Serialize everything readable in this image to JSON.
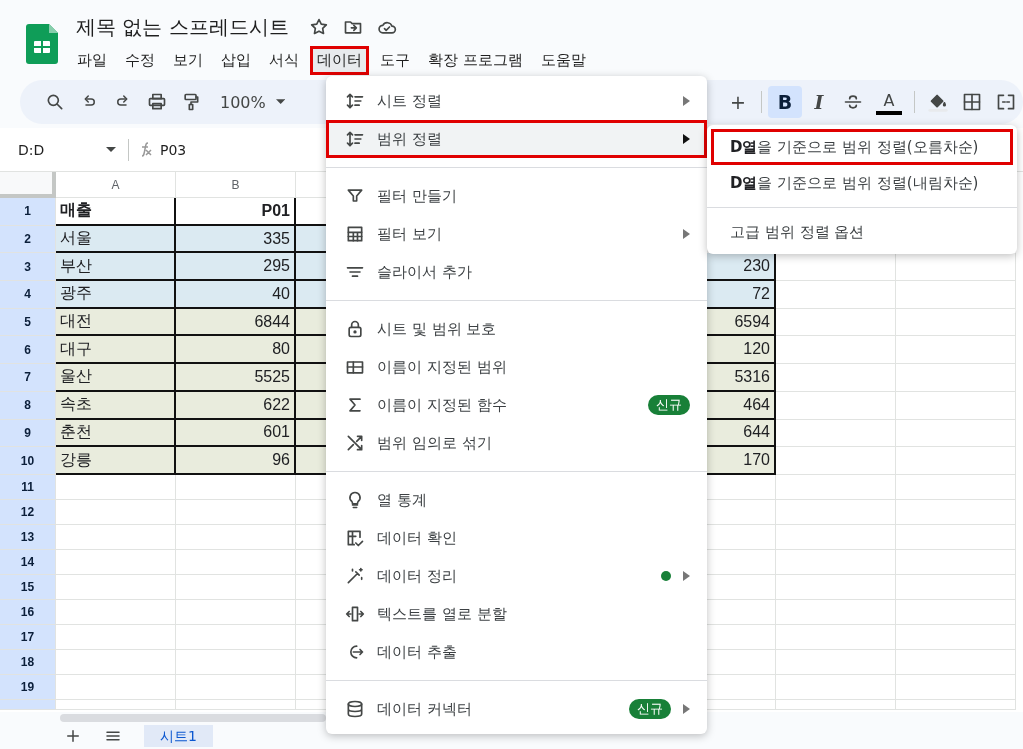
{
  "title": "제목 없는 스프레드시트",
  "menubar": [
    {
      "label": "파일",
      "selected": false
    },
    {
      "label": "수정",
      "selected": false
    },
    {
      "label": "보기",
      "selected": false
    },
    {
      "label": "삽입",
      "selected": false
    },
    {
      "label": "서식",
      "selected": false
    },
    {
      "label": "데이터",
      "selected": true
    },
    {
      "label": "도구",
      "selected": false
    },
    {
      "label": "확장 프로그램",
      "selected": false
    },
    {
      "label": "도움말",
      "selected": false
    }
  ],
  "toolbar": {
    "zoom": "100%",
    "buttons": [
      {
        "label": "+",
        "selected": false
      },
      {
        "label": "B",
        "selected": true
      },
      {
        "label": "I",
        "selected": false
      },
      {
        "label": "A",
        "selected": false
      }
    ]
  },
  "formula_bar": {
    "name_box": "D:D",
    "formula": "P03"
  },
  "grid": {
    "columns": [
      "A",
      "B"
    ],
    "rows": [
      {
        "number": "1",
        "kind": "header",
        "color": "#ffffff",
        "a": "매출",
        "b": "P01"
      },
      {
        "number": "2",
        "kind": "data",
        "color": "#dbeaf2",
        "a": "서울",
        "b": "335"
      },
      {
        "number": "3",
        "kind": "data",
        "color": "#dbeaf2",
        "a": "부산",
        "b": "295",
        "column_3": "230"
      },
      {
        "number": "4",
        "kind": "data",
        "color": "#dbeaf2",
        "a": "광주",
        "b": "40",
        "column_3": "72"
      },
      {
        "number": "5",
        "kind": "data",
        "color": "#e9ecdd",
        "a": "대전",
        "b": "6844",
        "column_3": "6594"
      },
      {
        "number": "6",
        "kind": "data",
        "color": "#e9ecdd",
        "a": "대구",
        "b": "80",
        "column_3": "120"
      },
      {
        "number": "7",
        "kind": "data",
        "color": "#e9ecdd",
        "a": "울산",
        "b": "5525",
        "column_3": "5316"
      },
      {
        "number": "8",
        "kind": "data",
        "color": "#e9ecdd",
        "a": "속초",
        "b": "622",
        "column_3": "464"
      },
      {
        "number": "9",
        "kind": "data",
        "color": "#e9ecdd",
        "a": "춘천",
        "b": "601",
        "column_3": "644"
      },
      {
        "number": "10",
        "kind": "data",
        "color": "#e9ecdd",
        "a": "강릉",
        "b": "96",
        "column_3": "170"
      }
    ],
    "empty_rows": [
      "11",
      "12",
      "13",
      "14",
      "15",
      "16",
      "17",
      "18",
      "19"
    ]
  },
  "data_menu": {
    "items": [
      {
        "kind": "item",
        "label": "시트 정렬",
        "submenu": true,
        "selected": false
      },
      {
        "kind": "item",
        "label": "범위 정렬",
        "submenu": true,
        "selected": true
      },
      {
        "kind": "separator"
      },
      {
        "kind": "item",
        "label": "필터 만들기",
        "submenu": false,
        "selected": false
      },
      {
        "kind": "item",
        "label": "필터 보기",
        "submenu": true,
        "selected": false
      },
      {
        "kind": "item",
        "label": "슬라이서 추가",
        "submenu": false,
        "selected": false
      },
      {
        "kind": "separator"
      },
      {
        "kind": "item",
        "label": "시트 및 범위 보호",
        "submenu": false,
        "selected": false
      },
      {
        "kind": "item",
        "label": "이름이 지정된 범위",
        "submenu": false,
        "selected": false
      },
      {
        "kind": "item",
        "label": "이름이 지정된 함수",
        "submenu": false,
        "selected": false,
        "badge": "신규"
      },
      {
        "kind": "item",
        "label": "범위 임의로 섞기",
        "submenu": false,
        "selected": false
      },
      {
        "kind": "separator"
      },
      {
        "kind": "item",
        "label": "열 통계",
        "submenu": false,
        "selected": false
      },
      {
        "kind": "item",
        "label": "데이터 확인",
        "submenu": false,
        "selected": false
      },
      {
        "kind": "item",
        "label": "데이터 정리",
        "submenu": true,
        "selected": false,
        "dot": true
      },
      {
        "kind": "item",
        "label": "텍스트를 열로 분할",
        "submenu": false,
        "selected": false
      },
      {
        "kind": "item",
        "label": "데이터 추출",
        "submenu": false,
        "selected": false
      },
      {
        "kind": "separator"
      },
      {
        "kind": "item",
        "label": "데이터 커넥터",
        "submenu": true,
        "selected": false,
        "badge": "신규"
      }
    ]
  },
  "sort_submenu": {
    "items": [
      {
        "kind": "item",
        "label": "**D열**을 기준으로 범위 정렬(오름차순)",
        "selected": true
      },
      {
        "kind": "item",
        "label": "**D열**을 기준으로 범위 정렬(내림차순)",
        "selected": false
      },
      {
        "kind": "separator"
      },
      {
        "kind": "item",
        "label": "고급 범위 정렬 옵션",
        "selected": false
      }
    ]
  },
  "sheet_tabs": [
    {
      "label": "시트1",
      "selected": true
    }
  ]
}
